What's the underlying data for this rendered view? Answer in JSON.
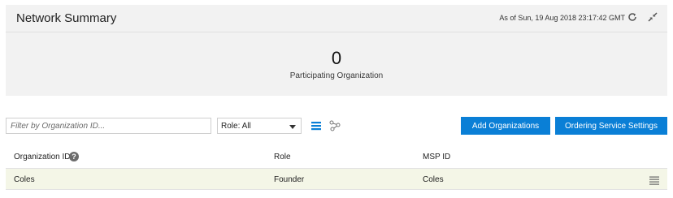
{
  "summary": {
    "title": "Network Summary",
    "as_of": "As of Sun, 19 Aug 2018 23:17:42 GMT",
    "count": "0",
    "count_label": "Participating Organization"
  },
  "toolbar": {
    "filter_placeholder": "Filter by Organization ID...",
    "role_filter_value": "Role: All",
    "add_organizations_label": "Add Organizations",
    "ordering_service_label": "Ordering Service Settings"
  },
  "table": {
    "columns": [
      "Organization ID",
      "Role",
      "MSP ID"
    ],
    "rows": [
      {
        "org_id": "Coles",
        "role": "Founder",
        "msp_id": "Coles"
      }
    ]
  },
  "icons": {
    "refresh": "refresh-icon",
    "collapse": "collapse-icon",
    "list_view": "list-view-icon",
    "graph_view": "graph-view-icon",
    "help": "help-icon",
    "row_menu": "row-menu-icon"
  },
  "colors": {
    "accent": "#0a7fd6",
    "summary_bg": "#f2f2f2",
    "row_highlight": "#f4f6e7"
  }
}
